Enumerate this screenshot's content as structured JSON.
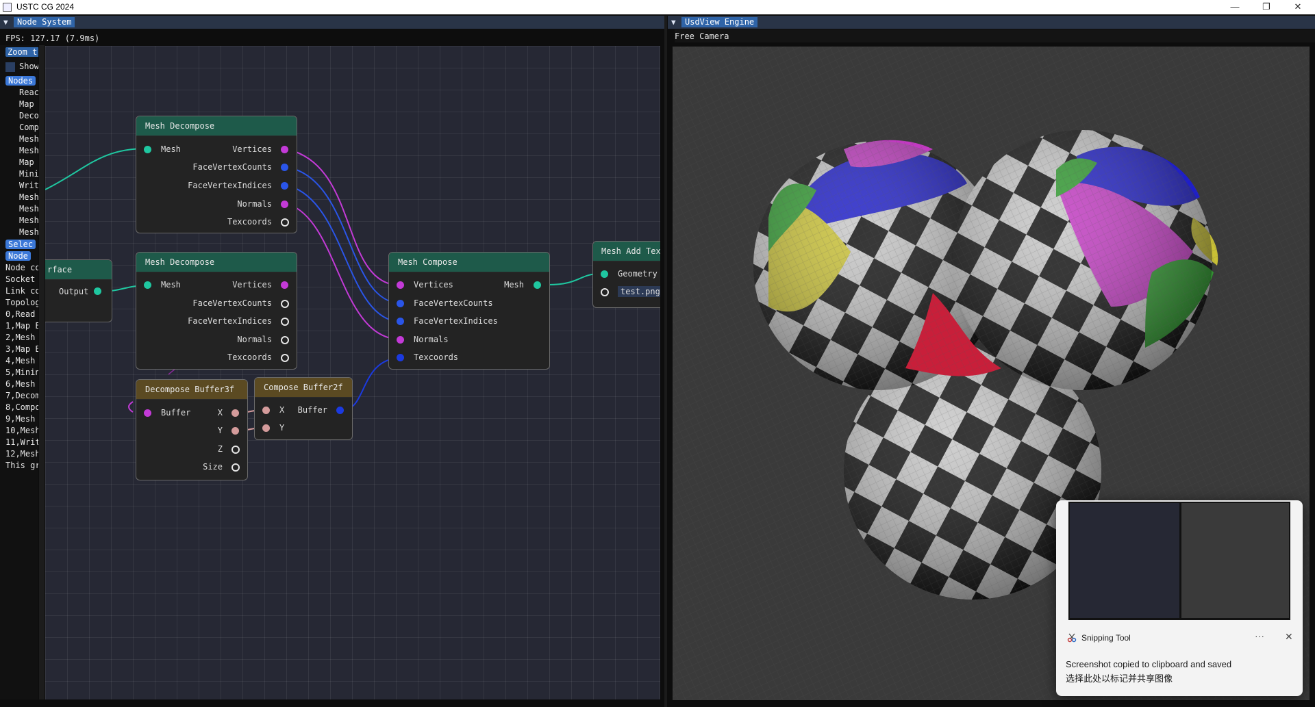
{
  "window": {
    "title": "USTC CG 2024",
    "minimize": "—",
    "restore": "❐",
    "close": "✕"
  },
  "node_panel": {
    "tab": "Node System",
    "fps": "FPS: 127.17 (7.9ms)",
    "zoom_button": "Zoom t",
    "show_label": "Show",
    "nodes_header": "Nodes",
    "node_items": [
      "Reac",
      "Map",
      "Deco",
      "Comp",
      "Mesh",
      "Mesh",
      "Map",
      "Mini",
      "Writ",
      "Mesh",
      "Mesh",
      "Mesh",
      "Mesh"
    ],
    "selected_header": "Selec",
    "node_header2": "Node",
    "info_lines": [
      "Node co",
      "Socket",
      "Link co",
      "Topolog",
      "0,Read",
      "1,Map E",
      "2,Mesh",
      "3,Map E",
      "4,Mesh",
      "5,Minin",
      "6,Mesh",
      "7,Decom",
      "8,Compo",
      "9,Mesh",
      "10,Mesh",
      "11,Writ",
      "12,Mesh",
      "This gr"
    ]
  },
  "nodes": {
    "decompose1": {
      "title": "Mesh Decompose",
      "input": "Mesh",
      "outputs": [
        "Vertices",
        "FaceVertexCounts",
        "FaceVertexIndices",
        "Normals",
        "Texcoords"
      ]
    },
    "decompose2": {
      "title": "Mesh Decompose",
      "input": "Mesh",
      "outputs": [
        "Vertices",
        "FaceVertexCounts",
        "FaceVertexIndices",
        "Normals",
        "Texcoords"
      ]
    },
    "surface": {
      "title": "rface",
      "output": "Output"
    },
    "compose": {
      "title": "Mesh Compose",
      "inputs": [
        "Vertices",
        "FaceVertexCounts",
        "FaceVertexIndices",
        "Normals",
        "Texcoords"
      ],
      "output": "Mesh"
    },
    "add_texture": {
      "title": "Mesh Add Tex",
      "input": "Geometry",
      "file": "test.png"
    },
    "buffer3f": {
      "title": "Decompose Buffer3f",
      "input": "Buffer",
      "outputs": [
        "X",
        "Y",
        "Z",
        "Size"
      ]
    },
    "buffer2f": {
      "title": "Compose Buffer2f",
      "inputs": [
        "X",
        "Y"
      ],
      "output": "Buffer"
    }
  },
  "viewport": {
    "tab": "UsdView Engine",
    "camera": "Free Camera"
  },
  "toast": {
    "app": "Snipping Tool",
    "more": "···",
    "close": "✕",
    "line1": "Screenshot copied to clipboard and saved",
    "line2": "选择此处以标记并共享图像"
  },
  "colors": {
    "teal_pin": "#1fc7a0",
    "magenta_pin": "#c33ad7",
    "blue_pin": "#2a55e8",
    "pink_pin": "#d49b9b",
    "tab_blue": "#2f64a8"
  }
}
